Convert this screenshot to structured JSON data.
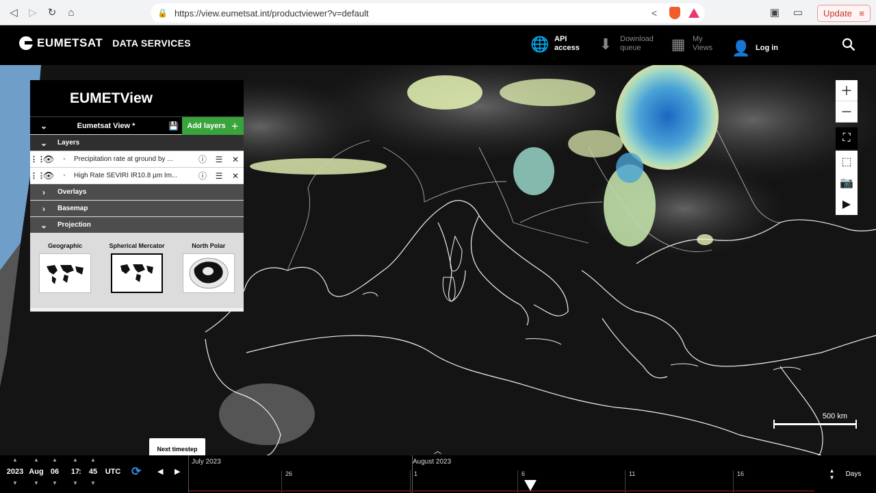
{
  "browser": {
    "url": "https://view.eumetsat.int/productviewer?v=default",
    "update_label": "Update"
  },
  "header": {
    "brand": "EUMETSAT",
    "section": "DATA SERVICES",
    "nav": [
      {
        "line1": "API",
        "line2": "access"
      },
      {
        "line1": "Download",
        "line2": "queue"
      },
      {
        "line1": "My",
        "line2": "Views"
      },
      {
        "line1": "Log in",
        "line2": ""
      }
    ]
  },
  "panel": {
    "title": "EUMETView",
    "view_name": "Eumetsat View *",
    "add_layers": "Add layers",
    "sections": {
      "layers": "Layers",
      "overlays": "Overlays",
      "basemap": "Basemap",
      "projection": "Projection"
    },
    "layers": [
      {
        "name": "Precipitation rate at ground by ..."
      },
      {
        "name": "High Rate SEVIRI IR10.8 µm Im..."
      }
    ],
    "projections": [
      {
        "label": "Geographic",
        "selected": false
      },
      {
        "label": "Spherical Mercator",
        "selected": true
      },
      {
        "label": "North Polar",
        "selected": false
      }
    ]
  },
  "map": {
    "scale_label": "500 km"
  },
  "timebar": {
    "tooltip": "Next timestep",
    "year": "2023",
    "month": "Aug",
    "day": "06",
    "hour": "17",
    "sep": ":",
    "minute": "45",
    "tz": "UTC",
    "months": [
      "July 2023",
      "August 2023"
    ],
    "ticks": [
      "26",
      "1",
      "6",
      "11",
      "16"
    ],
    "unit": "Days"
  },
  "colors": {
    "accent_green": "#39a33c",
    "precip_low": "#e6f5b5",
    "precip_high": "#1a66c2"
  }
}
